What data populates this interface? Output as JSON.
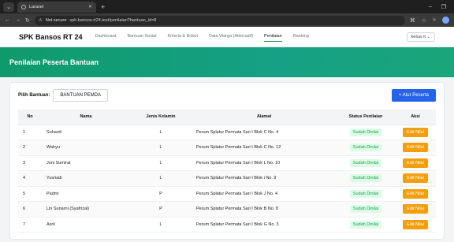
{
  "browser": {
    "tab_title": "Laravel",
    "not_secure": "Not secure",
    "url": "spk-bansos-rt24.test/penilaian?bantuan_id=8"
  },
  "app": {
    "brand": "SPK Bansos RT 24",
    "nav": [
      "Dashboard",
      "Bantuan Sosial",
      "Kriteria & Bobot",
      "Data Warga (Alternatif)",
      "Penilaian",
      "Ranking"
    ],
    "active_nav": "Penilaian",
    "user": "ketua rt"
  },
  "hero": {
    "title": "Penilaian Peserta Bantuan"
  },
  "toolbar": {
    "filter_label": "Pilih Bantuan:",
    "filter_value": "BANTUAN PEMDA",
    "add_button": "+ Atur Peserta"
  },
  "table": {
    "headers": [
      "No",
      "Nama",
      "Jenis Kelamin",
      "Alamat",
      "Status Penilaian",
      "Aksi"
    ],
    "rows": [
      [
        "1",
        "Suhardi",
        "L",
        "Perum Splatur Permata Sari I Blok C No. 4",
        "Sudah Dinilai",
        "Edit Nilai"
      ],
      [
        "2",
        "Wahyu",
        "L",
        "Perum Splatur Permata Sari I Blok C No. 12",
        "Sudah Dinilai",
        "Edit Nilai"
      ],
      [
        "3",
        "Joni Sumirat",
        "L",
        "Perum Splatur Permata Sari I Blok L No. 10",
        "Sudah Dinilai",
        "Edit Nilai"
      ],
      [
        "4",
        "Yusriadi",
        "L",
        "Perum Splatur Permata Sari I Blok i No. 9",
        "Sudah Dinilai",
        "Edit Nilai"
      ],
      [
        "5",
        "Padmi",
        "P",
        "Perum Splatur Permata Sari I Blok J No. 4",
        "Sudah Dinilai",
        "Edit Nilai"
      ],
      [
        "6",
        "Lin Sunarni (Syafrizal)",
        "P",
        "Perum Splatur Permata Sari I Blok B No. 8",
        "Sudah Dinilai",
        "Edit Nilai"
      ],
      [
        "7",
        "Asril",
        "L",
        "Perum Splatur Permata Sari I Blok G No. 3",
        "Sudah Dinilai",
        "Edit Nilai"
      ]
    ]
  }
}
